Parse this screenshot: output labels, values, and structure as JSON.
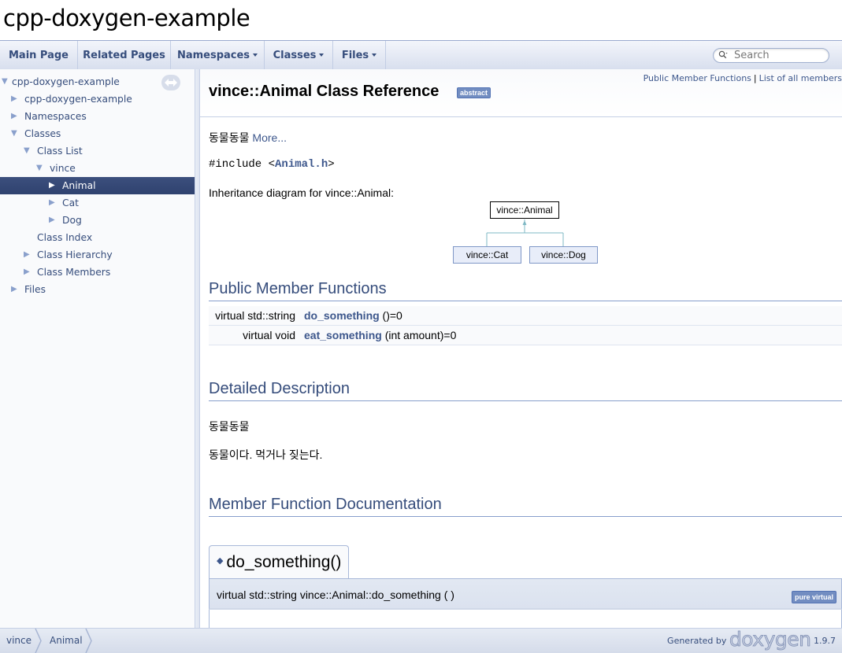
{
  "project": {
    "name": "cpp-doxygen-example"
  },
  "navbar": {
    "items": [
      {
        "label": "Main Page"
      },
      {
        "label": "Related Pages"
      },
      {
        "label": "Namespaces"
      },
      {
        "label": "Classes"
      },
      {
        "label": "Files"
      }
    ],
    "search_placeholder": "Search"
  },
  "sidebar": {
    "items": [
      {
        "label": "cpp-doxygen-example",
        "state": "expanded"
      },
      {
        "label": "cpp-doxygen-example",
        "state": "collapsed"
      },
      {
        "label": "Namespaces",
        "state": "collapsed"
      },
      {
        "label": "Classes",
        "state": "expanded"
      },
      {
        "label": "Class List",
        "state": "expanded"
      },
      {
        "label": "vince",
        "state": "expanded"
      },
      {
        "label": "Animal",
        "state": "collapsed",
        "selected": true
      },
      {
        "label": "Cat",
        "state": "collapsed"
      },
      {
        "label": "Dog",
        "state": "collapsed"
      },
      {
        "label": "Class Index",
        "state": "leaf"
      },
      {
        "label": "Class Hierarchy",
        "state": "collapsed"
      },
      {
        "label": "Class Members",
        "state": "collapsed"
      },
      {
        "label": "Files",
        "state": "collapsed"
      }
    ]
  },
  "header": {
    "summary_links": [
      "Public Member Functions",
      "List of all members"
    ],
    "summary_sep": "|",
    "title": "vince::Animal Class Reference",
    "badge": "abstract"
  },
  "content": {
    "brief_text": "동물동물",
    "more_link": "More...",
    "include_prefix": "#include <",
    "include_file": "Animal.h",
    "include_suffix": ">",
    "inheritance_label": "Inheritance diagram for vince::Animal:",
    "diagram": {
      "base": "vince::Animal",
      "derived": [
        "vince::Cat",
        "vince::Dog"
      ]
    },
    "public_member_functions_title": "Public Member Functions",
    "members": [
      {
        "ret": "virtual std::string",
        "name": "do_something",
        "args": " ()=0"
      },
      {
        "ret": "virtual void",
        "name": "eat_something",
        "args": " (int amount)=0"
      }
    ],
    "detailed_title": "Detailed Description",
    "detailed_p1": "동물동물",
    "detailed_p2": "동물이다. 먹거나 짖는다.",
    "member_doc_title": "Member Function Documentation",
    "member_doc_name": "do_something()",
    "member_doc_proto": "virtual std::string vince::Animal::do_something (  )",
    "member_doc_badge": "pure virtual"
  },
  "navpath": {
    "crumbs": [
      "vince",
      "Animal"
    ],
    "generated_by": "Generated by",
    "logo": "doxygen",
    "version": "1.9.7"
  },
  "colors": {
    "link": "#3d578c",
    "nav_text": "#364d7c",
    "selected_bg": "#34477a",
    "border": "#a8b8d9"
  }
}
